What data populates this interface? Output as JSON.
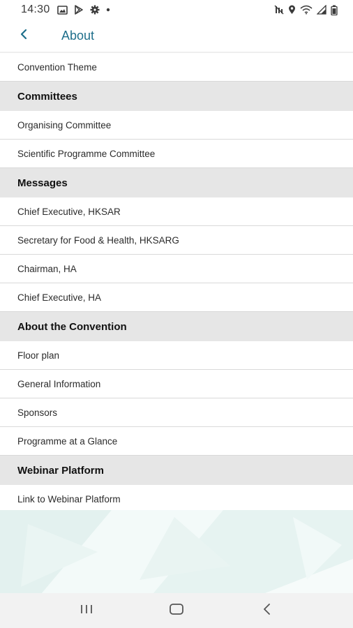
{
  "status_bar": {
    "time": "14:30",
    "left_icons": [
      "image-icon",
      "play-store-icon",
      "settings-icon",
      "dot-icon"
    ],
    "right_icons": [
      "mute-icon",
      "location-icon",
      "wifi-icon",
      "signal-icon",
      "battery-icon"
    ]
  },
  "app_bar": {
    "back_icon": "chevron-left-icon",
    "title": "About"
  },
  "list": {
    "item_convention_theme": "Convention Theme",
    "section_committees": "Committees",
    "item_organising_committee": "Organising Committee",
    "item_scientific_programme_committee": "Scientific Programme Committee",
    "section_messages": "Messages",
    "item_chief_executive_hksar": "Chief Executive, HKSAR",
    "item_secretary_food_health": "Secretary for Food & Health, HKSARG",
    "item_chairman_ha": "Chairman, HA",
    "item_chief_executive_ha": "Chief Executive, HA",
    "section_about_convention": "About the Convention",
    "item_floor_plan": "Floor plan",
    "item_general_information": "General Information",
    "item_sponsors": "Sponsors",
    "item_programme_at_a_glance": "Programme at a Glance",
    "section_webinar_platform": "Webinar Platform",
    "item_link_webinar_platform": "Link to Webinar Platform"
  },
  "nav_bar": {
    "recents_icon": "recents-icon",
    "home_icon": "home-icon",
    "back_icon": "back-icon"
  },
  "colors": {
    "accent": "#1f6f8b",
    "section_bg": "#e6e6e6",
    "divider": "#d9d9d9",
    "decor": "#eef7f6"
  }
}
